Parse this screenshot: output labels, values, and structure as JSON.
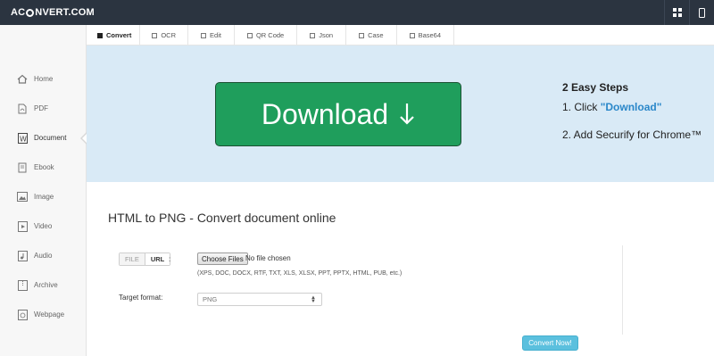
{
  "header": {
    "logo_left": "AC",
    "logo_right": "NVERT.COM",
    "icons": [
      "grid-icon",
      "mobile-icon"
    ]
  },
  "sidebar": {
    "items": [
      {
        "label": "Home",
        "icon": "home-icon"
      },
      {
        "label": "PDF",
        "icon": "pdf-icon"
      },
      {
        "label": "Document",
        "icon": "document-icon",
        "active": true
      },
      {
        "label": "Ebook",
        "icon": "ebook-icon"
      },
      {
        "label": "Image",
        "icon": "image-icon"
      },
      {
        "label": "Video",
        "icon": "video-icon"
      },
      {
        "label": "Audio",
        "icon": "audio-icon"
      },
      {
        "label": "Archive",
        "icon": "archive-icon"
      },
      {
        "label": "Webpage",
        "icon": "webpage-icon"
      }
    ]
  },
  "tabs": [
    {
      "label": "Convert",
      "active": true
    },
    {
      "label": "OCR"
    },
    {
      "label": "Edit"
    },
    {
      "label": "QR Code"
    },
    {
      "label": "Json"
    },
    {
      "label": "Case"
    },
    {
      "label": "Base64"
    }
  ],
  "banner": {
    "download_label": "Download",
    "steps_title": "2 Easy Steps",
    "step1_prefix": "1. Click ",
    "step1_link": "\"Download\"",
    "step2": "2. Add Securify for Chrome™",
    "button_color": "#1f9e5c"
  },
  "main": {
    "title": "HTML to PNG - Convert document online",
    "source_toggle": {
      "file": "FILE",
      "url": "URL",
      "selected": "URL"
    },
    "colon": ":",
    "choose_files_label": "Choose Files",
    "no_file_text": "No file chosen",
    "formats_text": "(XPS, DOC, DOCX, RTF, TXT, XLS, XLSX, PPT, PPTX, HTML, PUB, etc.)",
    "target_format_label": "Target format:",
    "target_format_value": "PNG",
    "convert_button": "Convert Now!"
  }
}
